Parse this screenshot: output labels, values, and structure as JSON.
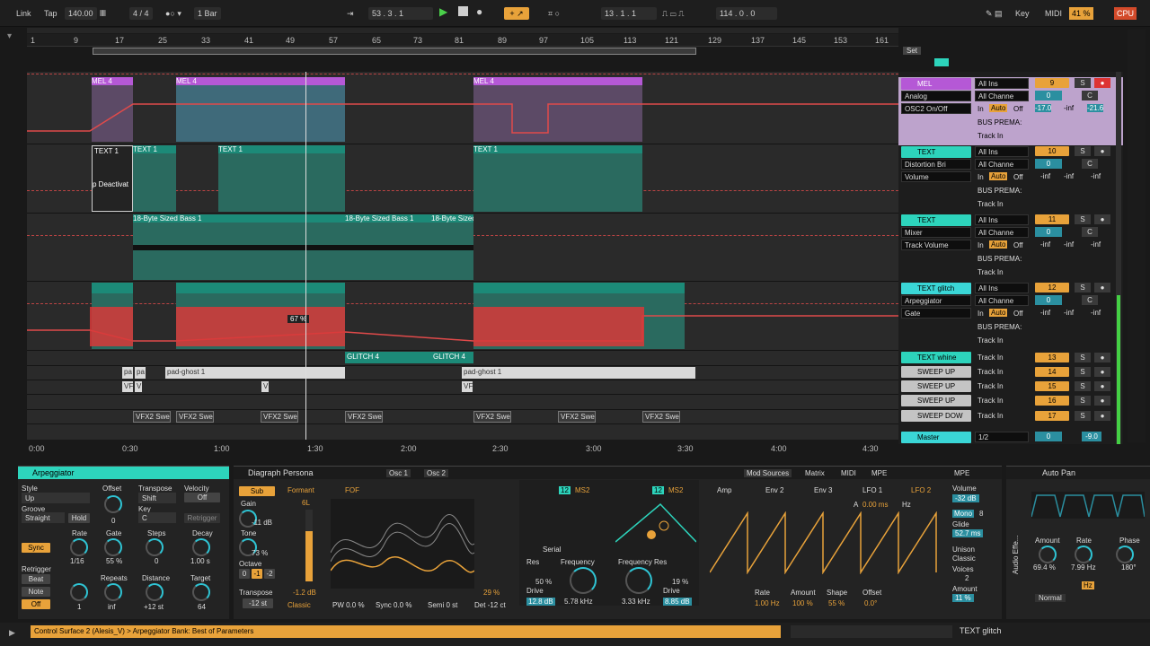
{
  "transport": {
    "link": "Link",
    "tap": "Tap",
    "tempo": "140.00",
    "signature": "4 / 4",
    "quant": "1 Bar",
    "position": "53 .   3 .   1",
    "loop_start": "13 .   1 .   1",
    "loop_len": "114 .   0 .   0",
    "key": "Key",
    "midi": "MIDI",
    "cpu_pct": "41 %",
    "cpu": "CPU"
  },
  "ruler": [
    "1",
    "9",
    "17",
    "25",
    "33",
    "41",
    "49",
    "57",
    "65",
    "73",
    "81",
    "89",
    "97",
    "105",
    "113",
    "121",
    "129",
    "137",
    "145",
    "153",
    "161"
  ],
  "timeline": [
    "0:00",
    "0:30",
    "1:00",
    "1:30",
    "2:00",
    "2:30",
    "3:00",
    "3:30",
    "4:00",
    "4:30"
  ],
  "set_label": "Set",
  "clips": {
    "mel": "MEL 4",
    "text": "TEXT 1",
    "bass": "18-Byte Sized Bass 1",
    "deact": "p Deactivat",
    "glitch": "GLITCH 4",
    "ghost": "pad-ghost 1",
    "vfx": "VFX2 Swe",
    "tooltip": "67 %",
    "pa": "pa",
    "v": "V",
    "vf": "VF"
  },
  "tracks": [
    {
      "name": "MEL",
      "num": "9",
      "in": "All Ins",
      "chan": "All Channe",
      "dev": "Analog",
      "param": "OSC2 On/Off",
      "vol": "0",
      "pan": "C",
      "a": "-17.0",
      "b": "-inf",
      "c": "-21.6"
    },
    {
      "name": "TEXT",
      "num": "10",
      "in": "All Ins",
      "chan": "All Channe",
      "dev": "Distortion Bri",
      "param": "Volume",
      "vol": "0",
      "pan": "C",
      "a": "-inf",
      "b": "-inf",
      "c": "-inf"
    },
    {
      "name": "TEXT",
      "num": "11",
      "in": "All Ins",
      "chan": "All Channe",
      "dev": "Mixer",
      "param": "Track Volume",
      "vol": "0",
      "pan": "C",
      "a": "-inf",
      "b": "-inf",
      "c": "-inf"
    },
    {
      "name": "TEXT glitch",
      "num": "12",
      "in": "All Ins",
      "chan": "All Channe",
      "dev": "Arpeggiator",
      "param": "Gate",
      "vol": "0",
      "pan": "C",
      "a": "-inf",
      "b": "-inf",
      "c": "-inf"
    }
  ],
  "small_tracks": [
    {
      "name": "TEXT whine",
      "num": "13"
    },
    {
      "name": "SWEEP UP",
      "num": "14"
    },
    {
      "name": "SWEEP UP",
      "num": "15"
    },
    {
      "name": "SWEEP UP",
      "num": "16"
    },
    {
      "name": "SWEEP DOW",
      "num": "17"
    }
  ],
  "mix_common": {
    "in": "In",
    "auto": "Auto",
    "off": "Off",
    "bus": "BUS PREMA:",
    "track_in": "Track In",
    "s": "S"
  },
  "master": {
    "name": "Master",
    "io": "1/2",
    "vol": "0",
    "db": "-9.0"
  },
  "arp": {
    "title": "Arpeggiator",
    "style": "Style",
    "style_v": "Up",
    "groove": "Groove",
    "groove_v": "Straight",
    "hold": "Hold",
    "offset": "Offset",
    "offset_v": "0",
    "transpose": "Transpose",
    "transpose_v": "Shift",
    "key": "Key",
    "key_v": "C",
    "velocity": "Velocity",
    "velocity_v": "Off",
    "retrig_btn": "Retrigger",
    "sync": "Sync",
    "rate": "Rate",
    "rate_v": "1/16",
    "gate": "Gate",
    "gate_v": "55 %",
    "steps": "Steps",
    "steps_v": "0",
    "decay": "Decay",
    "decay_v": "1.00 s",
    "retrigger": "Retrigger",
    "beat": "Beat",
    "note": "Note",
    "off": "Off",
    "repeats": "Repeats",
    "repeats_v": "inf",
    "distance": "Distance",
    "distance_v": "+12 st",
    "target": "Target",
    "target_v": "64",
    "one": "1"
  },
  "synth": {
    "title": "Diagraph Persona",
    "osc1": "Osc 1",
    "osc2": "Osc 2",
    "sub": "Sub",
    "gain": "Gain",
    "gain_v": "-11 dB",
    "tone": "Tone",
    "tone_v": "73 %",
    "octave": "Octave",
    "oct": [
      "0",
      "-1",
      "-2"
    ],
    "transpose": "Transpose",
    "transpose_v": "-12 st",
    "formant": "Formant",
    "fof": "FOF",
    "sixl": "6L",
    "db": "-1.2 dB",
    "classic": "Classic",
    "pw": "PW 0.0 %",
    "sync": "Sync 0.0 %",
    "semi": "Semi 0 st",
    "det": "Det -12 ct",
    "pct": "29 %",
    "ms2": "MS2",
    "twelve": "12",
    "serial": "Serial",
    "res": "Res",
    "res_v": "50 %",
    "freq": "Frequency",
    "freq_v": "5.78 kHz",
    "drive": "Drive",
    "drive_v": "12.8 dB",
    "fres": "Frequency Res",
    "fres_v": "19 %",
    "freq2_v": "3.33 kHz",
    "drive2_v": "8.85 dB",
    "mod_sources": "Mod Sources",
    "matrix": "Matrix",
    "midi": "MIDI",
    "mpe": "MPE",
    "amp": "Amp",
    "env2": "Env 2",
    "env3": "Env 3",
    "lfo1": "LFO 1",
    "lfo2": "LFO 2",
    "a": "A",
    "ms": "0.00 ms",
    "hz": "Hz",
    "rate": "Rate",
    "rate_v": "1.00 Hz",
    "amount": "Amount",
    "amount_v": "100 %",
    "shape": "Shape",
    "shape_v": "55 %",
    "offset": "Offset",
    "offset_v": "0.0°",
    "volume": "Volume",
    "volume_v": "-32 dB",
    "mono": "Mono",
    "voices_n": "8",
    "glide": "Glide",
    "glide_v": "52.7 ms",
    "unison": "Unison",
    "unison_v": "Classic",
    "voices": "Voices",
    "voices_v": "2",
    "amount2": "Amount",
    "amount2_v": "11 %",
    "mpe_btn": "MPE"
  },
  "autopan": {
    "title": "Auto Pan",
    "side": "Audio Effe...",
    "amount": "Amount",
    "amount_v": "69.4 %",
    "rate": "Rate",
    "rate_v": "7.99 Hz",
    "phase": "Phase",
    "phase_v": "180°",
    "hz": "Hz",
    "normal": "Normal"
  },
  "status": {
    "text": "Control Surface 2 (Alesis_V) > Arpeggiator Bank: Best of Parameters",
    "track": "TEXT glitch"
  },
  "colors": {
    "accent": "#e8a23a",
    "teal": "#2dd4bc",
    "mel": "#b558d6",
    "automation": "#e04a4a"
  }
}
